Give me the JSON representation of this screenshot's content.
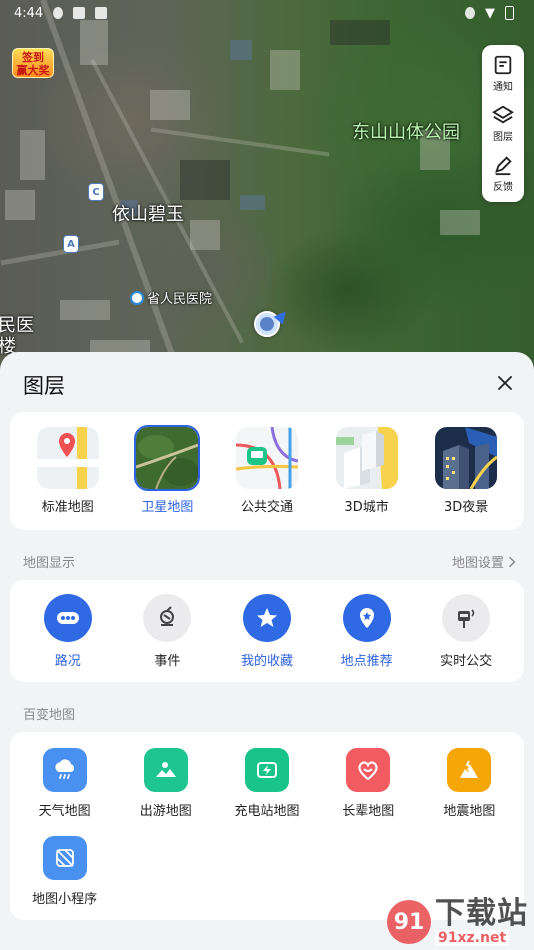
{
  "status_bar": {
    "time": "4:44"
  },
  "promo": {
    "line1": "签到",
    "line2": "赢大奖"
  },
  "map": {
    "labels": {
      "park": "东山山体公园",
      "estate": "依山碧玉",
      "hospital": "省人民医院",
      "edge_top": "民医",
      "edge_bottom": "楼"
    },
    "bus_markers": [
      "C",
      "A"
    ]
  },
  "side_tools": [
    {
      "icon": "notification-icon",
      "label": "通知"
    },
    {
      "icon": "layers-icon",
      "label": "图层"
    },
    {
      "icon": "feedback-icon",
      "label": "反馈"
    }
  ],
  "sheet": {
    "title": "图层",
    "layers": [
      {
        "label": "标准地图",
        "selected": false
      },
      {
        "label": "卫星地图",
        "selected": true
      },
      {
        "label": "公共交通",
        "selected": false
      },
      {
        "label": "3D城市",
        "selected": false
      },
      {
        "label": "3D夜景",
        "selected": false
      }
    ],
    "display_section": {
      "title": "地图显示",
      "link": "地图设置"
    },
    "display_items": [
      {
        "label": "路况",
        "on": true,
        "icon": "traffic-icon"
      },
      {
        "label": "事件",
        "on": false,
        "icon": "event-icon"
      },
      {
        "label": "我的收藏",
        "on": true,
        "icon": "star-icon"
      },
      {
        "label": "地点推荐",
        "on": true,
        "icon": "place-recommend-icon"
      },
      {
        "label": "实时公交",
        "on": false,
        "icon": "bus-stop-icon"
      }
    ],
    "variety_section": {
      "title": "百变地图"
    },
    "variety_items": [
      {
        "label": "天气地图",
        "icon": "weather-icon",
        "color": "#4a90f0"
      },
      {
        "label": "出游地图",
        "icon": "travel-icon",
        "color": "#1fc58f"
      },
      {
        "label": "充电站地图",
        "icon": "charging-icon",
        "color": "#19c48a"
      },
      {
        "label": "长辈地图",
        "icon": "elder-icon",
        "color": "#f25b60"
      },
      {
        "label": "地震地图",
        "icon": "earthquake-icon",
        "color": "#f5a70a"
      },
      {
        "label": "地图小程序",
        "icon": "mini-program-icon",
        "color": "#4a90f0"
      }
    ]
  },
  "watermark": {
    "logo": "91",
    "main": "下载站",
    "url": "91xz.net"
  }
}
